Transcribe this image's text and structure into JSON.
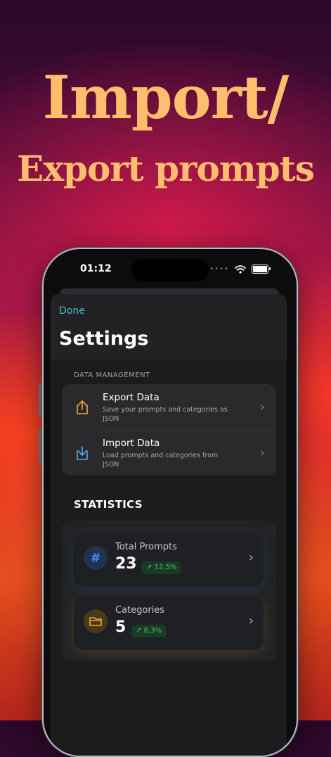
{
  "headline": {
    "line1": "Import/",
    "line2": "Export prompts"
  },
  "status_bar": {
    "time": "01:12"
  },
  "settings": {
    "done_label": "Done",
    "title": "Settings",
    "data_management": {
      "section_label": "DATA MANAGEMENT",
      "items": [
        {
          "label": "Export Data",
          "description": "Save your prompts and categories as JSON",
          "icon": "share-icon"
        },
        {
          "label": "Import Data",
          "description": "Load prompts and categories from JSON",
          "icon": "download-icon"
        }
      ]
    },
    "statistics": {
      "section_label": "STATISTICS",
      "cards": [
        {
          "label": "Total Prompts",
          "value": "23",
          "change": "↗ 12,5%",
          "icon": "hash-icon",
          "icon_color": "#3f8cff"
        },
        {
          "label": "Categories",
          "value": "5",
          "change": "↗ 8,3%",
          "icon": "folder-icon",
          "icon_color": "#f0a83a"
        }
      ]
    }
  },
  "colors": {
    "headline": "#ffbd6e",
    "accent": "#3fbfc8",
    "export_icon": "#f0a83a",
    "import_icon": "#5aa8e6",
    "positive": "#38c86a"
  }
}
